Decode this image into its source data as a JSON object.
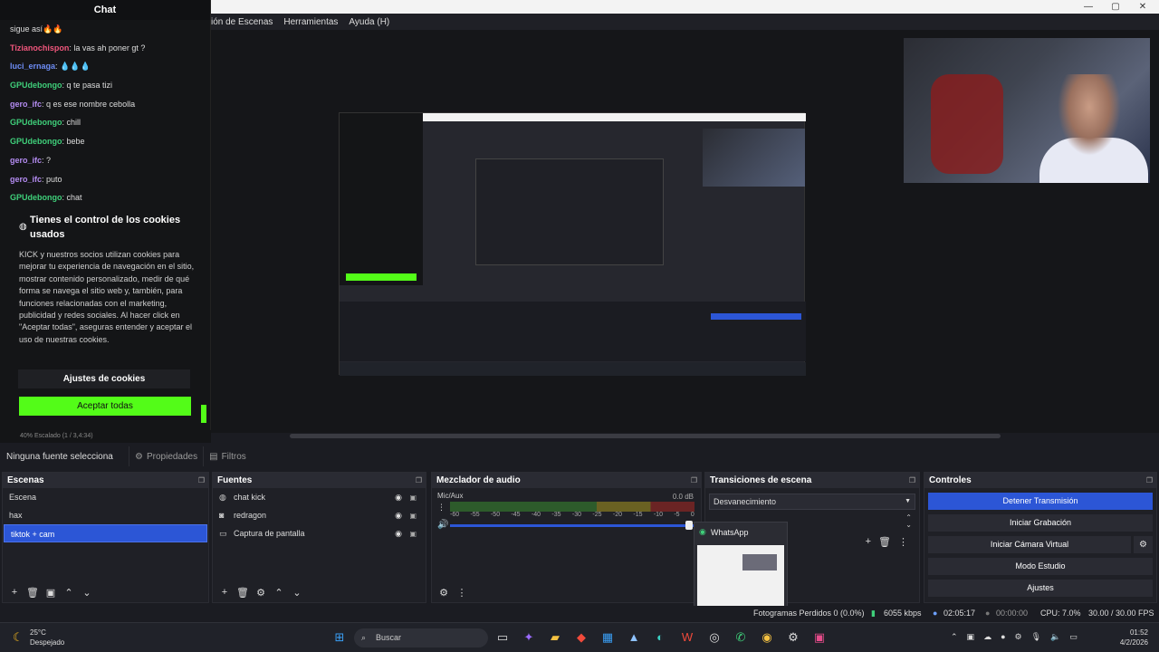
{
  "window": {
    "menu": [
      "ión de Escenas",
      "Herramientas",
      "Ayuda (H)"
    ],
    "controls": [
      "—",
      "▢",
      "✕"
    ]
  },
  "chat": {
    "title": "Chat",
    "messages": [
      {
        "user": "",
        "text": "sigue así🔥🔥",
        "color": "#dddddd"
      },
      {
        "user": "Tizianochispon",
        "text": ": la vas ah poner gt ?",
        "color": "#f0567c"
      },
      {
        "user": "luci_ernaga",
        "text": ": 💧💧💧",
        "color": "#6d8cf5"
      },
      {
        "user": "GPUdebongo",
        "text": ": q te pasa tizi",
        "color": "#3fcf7a"
      },
      {
        "user": "gero_ifc",
        "text": ": q es ese nombre cebolla",
        "color": "#b48cf2"
      },
      {
        "user": "GPUdebongo",
        "text": ": chill",
        "color": "#3fcf7a"
      },
      {
        "user": "GPUdebongo",
        "text": ": bebe",
        "color": "#3fcf7a"
      },
      {
        "user": "gero_ifc",
        "text": ": ?",
        "color": "#b48cf2"
      },
      {
        "user": "gero_ifc",
        "text": ": puto",
        "color": "#b48cf2"
      },
      {
        "user": "GPUdebongo",
        "text": ": chat",
        "color": "#3fcf7a"
      }
    ],
    "cookie": {
      "title": "Tienes el control de los cookies usados",
      "body": "KICK y nuestros socios utilizan cookies para mejorar tu experiencia de navegación en el sitio, mostrar contenido personalizado, medir de qué forma se navega el sitio web y, también, para funciones relacionadas con el marketing, publicidad y redes sociales. Al hacer click en \"Aceptar todas\", aseguras entender y aceptar el uso de nuestras cookies.",
      "settings_label": "Ajustes de cookies",
      "accept_label": "Aceptar todas",
      "accent": "#53fc18"
    }
  },
  "preview": {
    "zoom_text": "40%      Escalado (1 / 3,4:34)"
  },
  "source_toolbar": {
    "no_source": "Ninguna fuente selecciona",
    "properties": "Propiedades",
    "filters": "Filtros"
  },
  "docks": {
    "scenes": {
      "title": "Escenas",
      "items": [
        {
          "label": "Escena",
          "selected": false
        },
        {
          "label": "hax",
          "selected": false
        },
        {
          "label": "tiktok + cam",
          "selected": true
        }
      ]
    },
    "sources": {
      "title": "Fuentes",
      "items": [
        {
          "label": "chat kick",
          "icon": "browser-icon"
        },
        {
          "label": "redragon",
          "icon": "camera-icon"
        },
        {
          "label": "Captura de pantalla",
          "icon": "monitor-icon"
        }
      ]
    },
    "mixer": {
      "title": "Mezclador de audio",
      "channel": "Mic/Aux",
      "db": "0.0 dB",
      "ticks": [
        "-60",
        "-55",
        "-50",
        "-45",
        "-40",
        "-35",
        "-30",
        "-25",
        "-20",
        "-15",
        "-10",
        "-5",
        "0"
      ]
    },
    "transitions": {
      "title": "Transiciones de escena",
      "selected": "Desvanecimiento"
    },
    "controls": {
      "title": "Controles",
      "buttons": [
        "Detener Transmisión",
        "Iniciar Grabación",
        "Iniciar Cámara Virtual",
        "Modo Estudio",
        "Ajustes"
      ]
    }
  },
  "status": {
    "frames": "Fotogramas Perdidos 0 (0.0%)",
    "bitrate": "6055 kbps",
    "live_time": "02:05:17",
    "rec_time": "00:00:00",
    "cpu": "CPU: 7.0%",
    "fps": "30.00 / 30.00 FPS"
  },
  "whatsapp_popup": {
    "title": "WhatsApp"
  },
  "taskbar": {
    "weather_temp": "25°C",
    "weather_desc": "Despejado",
    "search_placeholder": "Buscar",
    "time": "01:52",
    "date": "4/2/2026"
  }
}
